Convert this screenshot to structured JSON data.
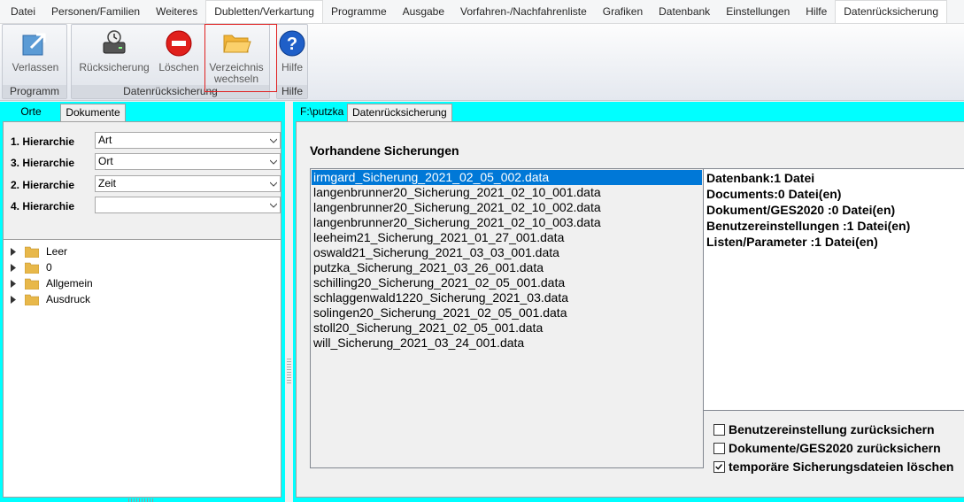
{
  "menu": {
    "tabs": [
      "Datei",
      "Personen/Familien",
      "Weiteres",
      "Dubletten/Verkartung",
      "Programme",
      "Ausgabe",
      "Vorfahren-/Nachfahrenliste",
      "Grafiken",
      "Datenbank",
      "Einstellungen",
      "Hilfe",
      "Datenrücksicherung"
    ]
  },
  "ribbon": {
    "groups": {
      "programm": "Programm",
      "datenruecksicherung": "Datenrücksicherung",
      "hilfe": "Hilfe"
    },
    "buttons": {
      "verlassen": "Verlassen",
      "ruecksicherung": "Rücksicherung",
      "loeschen": "Löschen",
      "verzeichnis_line1": "Verzeichnis",
      "verzeichnis_line2": "wechseln",
      "hilfe": "Hilfe"
    }
  },
  "left": {
    "tabs": [
      "Orte",
      "Dokumente"
    ],
    "hierarchies": [
      {
        "label": "1. Hierarchie",
        "value": "Art"
      },
      {
        "label": "3. Hierarchie",
        "value": "Ort"
      },
      {
        "label": "2. Hierarchie",
        "value": "Zeit"
      },
      {
        "label": "4. Hierarchie",
        "value": ""
      }
    ],
    "tree": [
      "Leer",
      "0",
      "Allgemein",
      "Ausdruck"
    ]
  },
  "right": {
    "tabs": [
      "F:\\putzka",
      "Datenrücksicherung"
    ],
    "section_title": "Vorhandene Sicherungen",
    "backups": [
      "irmgard_Sicherung_2021_02_05_002.data",
      "langenbrunner20_Sicherung_2021_02_10_001.data",
      "langenbrunner20_Sicherung_2021_02_10_002.data",
      "langenbrunner20_Sicherung_2021_02_10_003.data",
      "leeheim21_Sicherung_2021_01_27_001.data",
      "oswald21_Sicherung_2021_03_03_001.data",
      "putzka_Sicherung_2021_03_26_001.data",
      "schilling20_Sicherung_2021_02_05_001.data",
      "schlaggenwald1220_Sicherung_2021_03.data",
      "solingen20_Sicherung_2021_02_05_001.data",
      "stoll20_Sicherung_2021_02_05_001.data",
      "will_Sicherung_2021_03_24_001.data"
    ],
    "selected_backup": "irmgard_Sicherung_2021_02_05_002.data",
    "info": [
      "Datenbank:1 Datei",
      "Documents:0 Datei(en)",
      "Dokument/GES2020 :0 Datei(en)",
      "Benutzereinstellungen :1 Datei(en)",
      "Listen/Parameter :1 Datei(en)"
    ],
    "options": [
      {
        "label": "Benutzereinstellung zurücksichern",
        "checked": false
      },
      {
        "label": "Dokumente/GES2020 zurücksichern",
        "checked": false
      },
      {
        "label": "temporäre Sicherungsdateien löschen",
        "checked": true
      }
    ]
  },
  "colors": {
    "accent_cyan": "#00ffff",
    "selection": "#0078d7",
    "highlight_frame": "#e02020"
  }
}
